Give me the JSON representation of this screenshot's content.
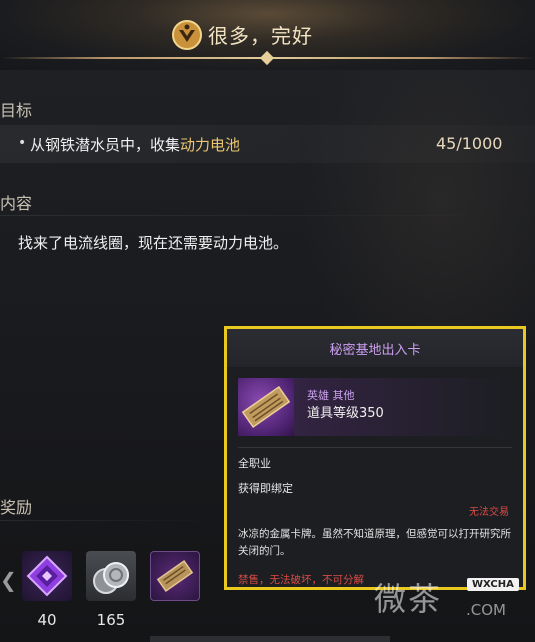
{
  "header": {
    "title": "很多，完好"
  },
  "objectives": {
    "label": "目标",
    "item": {
      "prefix": "从钢铁潜水员中，收集",
      "highlight": "动力电池",
      "progress": "45/1000"
    }
  },
  "content": {
    "label": "内容",
    "text": "找来了电流线圈，现在还需要动力电池。"
  },
  "rewards": {
    "label": "奖励",
    "items": [
      {
        "icon": "purple-gem-icon",
        "count": "40"
      },
      {
        "icon": "silver-coins-icon",
        "count": "165"
      },
      {
        "icon": "card-icon",
        "count": ""
      }
    ]
  },
  "tooltip": {
    "title": "秘密基地出入卡",
    "grade": "英雄 其他",
    "level": "道具等级350",
    "class": "全职业",
    "bind": "获得即绑定",
    "trade": "无法交易",
    "description": "冰凉的金属卡牌。虽然不知道原理，但感觉可以打开研究所关闭的门。",
    "restriction": "禁售，无法破坏，不可分解",
    "border_color": "#e9c81f",
    "grade_color": "#c9a0ee"
  },
  "watermark": {
    "text": "微茶",
    "badge": "WXCHA",
    "domain": ".COM"
  }
}
